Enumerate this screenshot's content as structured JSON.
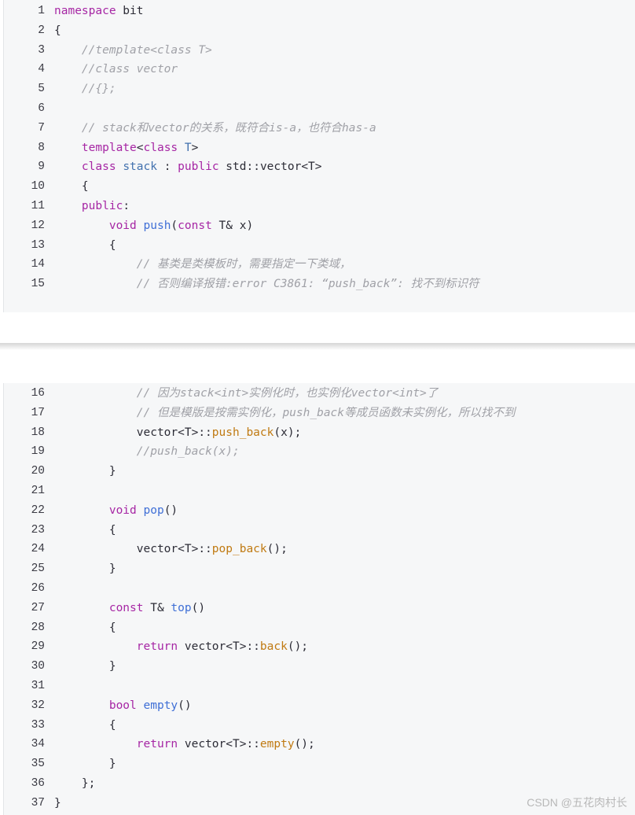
{
  "block1": {
    "lines": [
      {
        "n": "1",
        "segs": [
          {
            "t": "namespace",
            "c": "kw"
          },
          {
            "t": " bit",
            "c": "pl"
          }
        ]
      },
      {
        "n": "2",
        "segs": [
          {
            "t": "{",
            "c": "pl"
          }
        ]
      },
      {
        "n": "3",
        "segs": [
          {
            "t": "    ",
            "c": "pl"
          },
          {
            "t": "//template<class T>",
            "c": "cm"
          }
        ]
      },
      {
        "n": "4",
        "segs": [
          {
            "t": "    ",
            "c": "pl"
          },
          {
            "t": "//class vector",
            "c": "cm"
          }
        ]
      },
      {
        "n": "5",
        "segs": [
          {
            "t": "    ",
            "c": "pl"
          },
          {
            "t": "//{};",
            "c": "cm"
          }
        ]
      },
      {
        "n": "6",
        "segs": []
      },
      {
        "n": "7",
        "segs": [
          {
            "t": "    ",
            "c": "pl"
          },
          {
            "t": "// stack和vector的关系，既符合is-a，也符合has-a",
            "c": "cm"
          }
        ]
      },
      {
        "n": "8",
        "segs": [
          {
            "t": "    ",
            "c": "pl"
          },
          {
            "t": "template",
            "c": "kw"
          },
          {
            "t": "<",
            "c": "pl"
          },
          {
            "t": "class",
            "c": "kw"
          },
          {
            "t": " ",
            "c": "pl"
          },
          {
            "t": "T",
            "c": "ty"
          },
          {
            "t": ">",
            "c": "pl"
          }
        ]
      },
      {
        "n": "9",
        "segs": [
          {
            "t": "    ",
            "c": "pl"
          },
          {
            "t": "class",
            "c": "kw"
          },
          {
            "t": " ",
            "c": "pl"
          },
          {
            "t": "stack",
            "c": "ty"
          },
          {
            "t": " : ",
            "c": "pl"
          },
          {
            "t": "public",
            "c": "kw"
          },
          {
            "t": " std::vector<T>",
            "c": "pl"
          }
        ]
      },
      {
        "n": "10",
        "segs": [
          {
            "t": "    {",
            "c": "pl"
          }
        ]
      },
      {
        "n": "11",
        "segs": [
          {
            "t": "    ",
            "c": "pl"
          },
          {
            "t": "public",
            "c": "kw"
          },
          {
            "t": ":",
            "c": "pl"
          }
        ]
      },
      {
        "n": "12",
        "segs": [
          {
            "t": "        ",
            "c": "pl"
          },
          {
            "t": "void",
            "c": "kw"
          },
          {
            "t": " ",
            "c": "pl"
          },
          {
            "t": "push",
            "c": "fn"
          },
          {
            "t": "(",
            "c": "pl"
          },
          {
            "t": "const",
            "c": "kw"
          },
          {
            "t": " T& x)",
            "c": "pl"
          }
        ]
      },
      {
        "n": "13",
        "segs": [
          {
            "t": "        {",
            "c": "pl"
          }
        ]
      },
      {
        "n": "14",
        "segs": [
          {
            "t": "            ",
            "c": "pl"
          },
          {
            "t": "// 基类是类模板时，需要指定一下类域，",
            "c": "cm"
          }
        ]
      },
      {
        "n": "15",
        "segs": [
          {
            "t": "            ",
            "c": "pl"
          },
          {
            "t": "// 否则编译报错:error C3861: “push_back”: 找不到标识符",
            "c": "cm"
          }
        ]
      }
    ]
  },
  "block2": {
    "lines": [
      {
        "n": "16",
        "segs": [
          {
            "t": "            ",
            "c": "pl"
          },
          {
            "t": "// 因为stack<int>实例化时，也实例化vector<int>了",
            "c": "cm"
          }
        ]
      },
      {
        "n": "17",
        "segs": [
          {
            "t": "            ",
            "c": "pl"
          },
          {
            "t": "// 但是模版是按需实例化，push_back等成员函数未实例化，所以找不到",
            "c": "cm"
          }
        ]
      },
      {
        "n": "18",
        "segs": [
          {
            "t": "            vector<T>::",
            "c": "pl"
          },
          {
            "t": "push_back",
            "c": "mfn"
          },
          {
            "t": "(x);",
            "c": "pl"
          }
        ]
      },
      {
        "n": "19",
        "segs": [
          {
            "t": "            ",
            "c": "pl"
          },
          {
            "t": "//push_back(x);",
            "c": "cm"
          }
        ]
      },
      {
        "n": "20",
        "segs": [
          {
            "t": "        }",
            "c": "pl"
          }
        ]
      },
      {
        "n": "21",
        "segs": []
      },
      {
        "n": "22",
        "segs": [
          {
            "t": "        ",
            "c": "pl"
          },
          {
            "t": "void",
            "c": "kw"
          },
          {
            "t": " ",
            "c": "pl"
          },
          {
            "t": "pop",
            "c": "fn"
          },
          {
            "t": "()",
            "c": "pl"
          }
        ]
      },
      {
        "n": "23",
        "segs": [
          {
            "t": "        {",
            "c": "pl"
          }
        ]
      },
      {
        "n": "24",
        "segs": [
          {
            "t": "            vector<T>::",
            "c": "pl"
          },
          {
            "t": "pop_back",
            "c": "mfn"
          },
          {
            "t": "();",
            "c": "pl"
          }
        ]
      },
      {
        "n": "25",
        "segs": [
          {
            "t": "        }",
            "c": "pl"
          }
        ]
      },
      {
        "n": "26",
        "segs": []
      },
      {
        "n": "27",
        "segs": [
          {
            "t": "        ",
            "c": "pl"
          },
          {
            "t": "const",
            "c": "kw"
          },
          {
            "t": " T& ",
            "c": "pl"
          },
          {
            "t": "top",
            "c": "fn"
          },
          {
            "t": "()",
            "c": "pl"
          }
        ]
      },
      {
        "n": "28",
        "segs": [
          {
            "t": "        {",
            "c": "pl"
          }
        ]
      },
      {
        "n": "29",
        "segs": [
          {
            "t": "            ",
            "c": "pl"
          },
          {
            "t": "return",
            "c": "kw"
          },
          {
            "t": " vector<T>::",
            "c": "pl"
          },
          {
            "t": "back",
            "c": "mfn"
          },
          {
            "t": "();",
            "c": "pl"
          }
        ]
      },
      {
        "n": "30",
        "segs": [
          {
            "t": "        }",
            "c": "pl"
          }
        ]
      },
      {
        "n": "31",
        "segs": []
      },
      {
        "n": "32",
        "segs": [
          {
            "t": "        ",
            "c": "pl"
          },
          {
            "t": "bool",
            "c": "kw"
          },
          {
            "t": " ",
            "c": "pl"
          },
          {
            "t": "empty",
            "c": "fn"
          },
          {
            "t": "()",
            "c": "pl"
          }
        ]
      },
      {
        "n": "33",
        "segs": [
          {
            "t": "        {",
            "c": "pl"
          }
        ]
      },
      {
        "n": "34",
        "segs": [
          {
            "t": "            ",
            "c": "pl"
          },
          {
            "t": "return",
            "c": "kw"
          },
          {
            "t": " vector<T>::",
            "c": "pl"
          },
          {
            "t": "empty",
            "c": "mfn"
          },
          {
            "t": "();",
            "c": "pl"
          }
        ]
      },
      {
        "n": "35",
        "segs": [
          {
            "t": "        }",
            "c": "pl"
          }
        ]
      },
      {
        "n": "36",
        "segs": [
          {
            "t": "    };",
            "c": "pl"
          }
        ]
      },
      {
        "n": "37",
        "segs": [
          {
            "t": "}",
            "c": "pl"
          }
        ]
      }
    ]
  },
  "watermark": "CSDN @五花肉村长",
  "colors": {
    "background": "#f6f7f8",
    "keyword": "#a626a4",
    "type": "#4271ae",
    "function": "#3f6fd6",
    "member_function": "#c07a12",
    "comment": "#a0a1a7"
  }
}
